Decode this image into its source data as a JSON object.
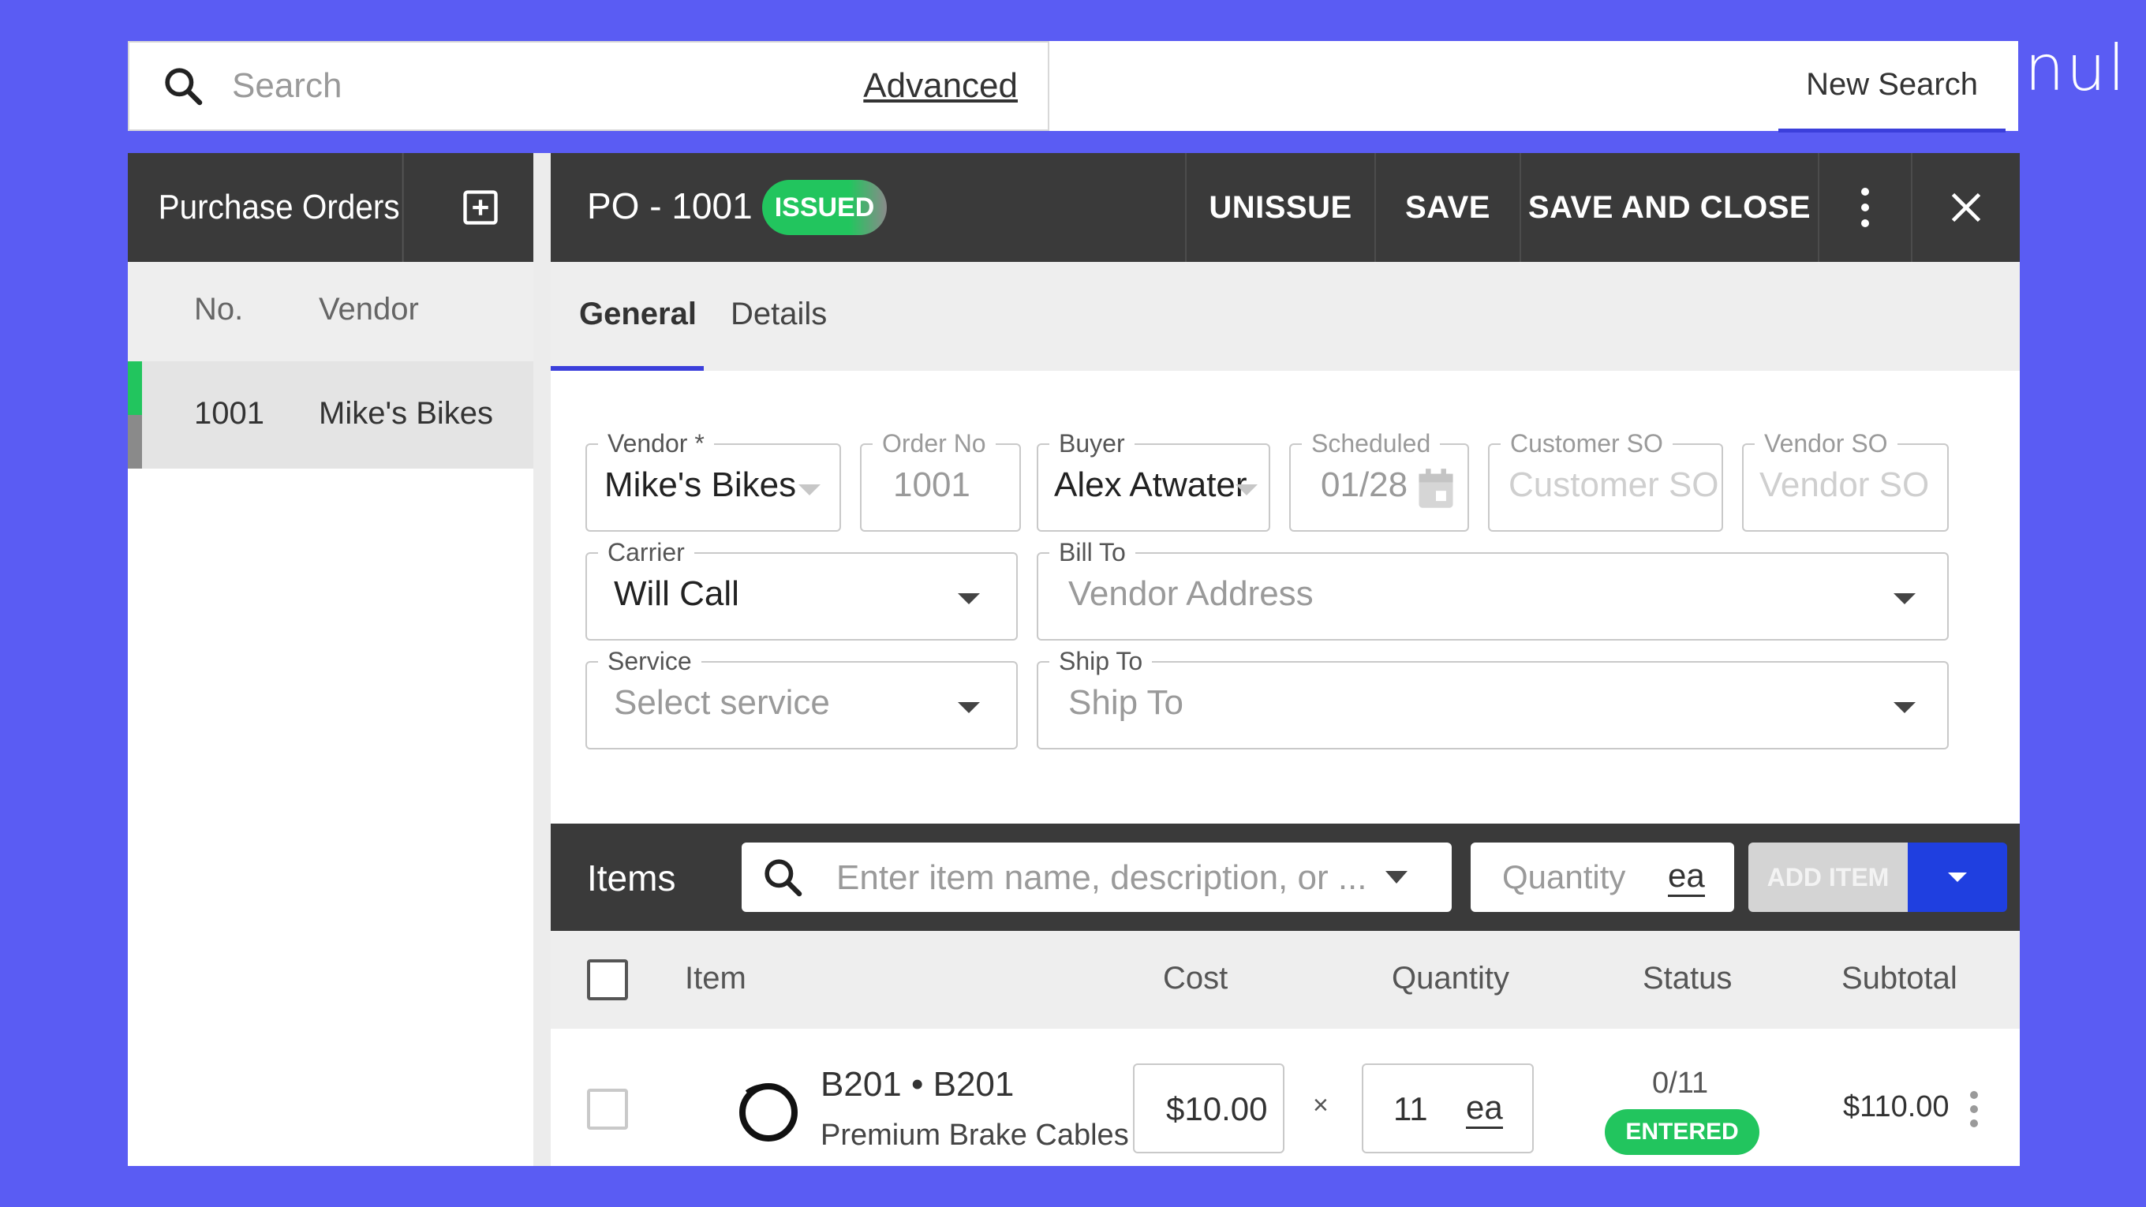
{
  "search": {
    "placeholder": "Search",
    "advanced_label": "Advanced",
    "new_search_label": "New Search"
  },
  "brand": {
    "text": "nul"
  },
  "left_panel": {
    "title": "Purchase Orders",
    "columns": [
      "No.",
      "Vendor"
    ],
    "rows": [
      {
        "no": "1001",
        "vendor": "Mike's Bikes",
        "status_colors": [
          "#22c55e",
          "#8a8a8a"
        ]
      }
    ]
  },
  "po": {
    "title": "PO - 1001",
    "status": "ISSUED",
    "actions": {
      "unissue": "UNISSUE",
      "save": "SAVE",
      "save_close": "SAVE AND CLOSE"
    }
  },
  "tabs": [
    "General",
    "Details"
  ],
  "form": {
    "vendor": {
      "label": "Vendor *",
      "value": "Mike's Bikes"
    },
    "order_no": {
      "label": "Order No",
      "value": "1001"
    },
    "buyer": {
      "label": "Buyer",
      "value": "Alex Atwater"
    },
    "scheduled": {
      "label": "Scheduled",
      "value": "01/28"
    },
    "customer_so": {
      "label": "Customer SO",
      "placeholder": "Customer SO"
    },
    "vendor_so": {
      "label": "Vendor SO",
      "placeholder": "Vendor SO"
    },
    "carrier": {
      "label": "Carrier",
      "value": "Will Call"
    },
    "bill_to": {
      "label": "Bill To",
      "placeholder": "Vendor Address"
    },
    "service": {
      "label": "Service",
      "placeholder": "Select service"
    },
    "ship_to": {
      "label": "Ship To",
      "placeholder": "Ship To"
    }
  },
  "items": {
    "label": "Items",
    "search_placeholder": "Enter item name, description, or ...",
    "quantity_placeholder": "Quantity",
    "unit": "ea",
    "add_label": "ADD ITEM",
    "columns": {
      "item": "Item",
      "cost": "Cost",
      "quantity": "Quantity",
      "status": "Status",
      "subtotal": "Subtotal"
    },
    "rows": [
      {
        "code": "B201 • B201",
        "description": "Premium Brake Cables",
        "cost": "$10.00",
        "times": "×",
        "quantity": "11",
        "unit": "ea",
        "received": "0/11",
        "status": "ENTERED",
        "subtotal": "$110.00"
      }
    ]
  },
  "colors": {
    "background": "#5a5cf3",
    "header": "#3a3a3a",
    "accent": "#3b3fdb",
    "success": "#22c55e",
    "primary_button": "#1f3fe0"
  }
}
